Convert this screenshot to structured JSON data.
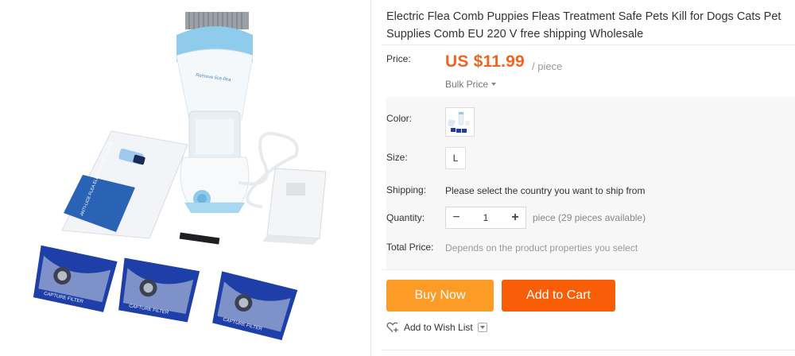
{
  "product": {
    "title": "Electric Flea Comb Puppies Fleas Treatment Safe Pets Kill for Dogs Cats Pet Supplies Comb EU 220 V free shipping Wholesale",
    "image_text": {
      "device_label": "Remove lice-flea",
      "booklet_text": "ANTI-LICE FLEA ELECTRIC PET COMB",
      "filter_text": "CAPTURE FILTER"
    }
  },
  "price": {
    "label": "Price:",
    "value": "US $11.99",
    "unit": "/ piece",
    "bulk_label": "Bulk Price"
  },
  "color": {
    "label": "Color:"
  },
  "size": {
    "label": "Size:",
    "options": [
      "L"
    ]
  },
  "shipping": {
    "label": "Shipping:",
    "text": "Please select the country you want to ship from"
  },
  "quantity": {
    "label": "Quantity:",
    "minus": "−",
    "value": "1",
    "plus": "+",
    "note": "piece (29 pieces available)"
  },
  "total": {
    "label": "Total Price:",
    "text": "Depends on the product properties you select"
  },
  "actions": {
    "buy_now": "Buy Now",
    "add_to_cart": "Add to Cart",
    "wish_list": "Add to Wish List"
  },
  "colors": {
    "price": "#f26322",
    "buy_now": "#fd9b27",
    "add_to_cart": "#f85d08",
    "filter_bag": "#1e3fa8",
    "device_blue": "#7ec5ea"
  }
}
